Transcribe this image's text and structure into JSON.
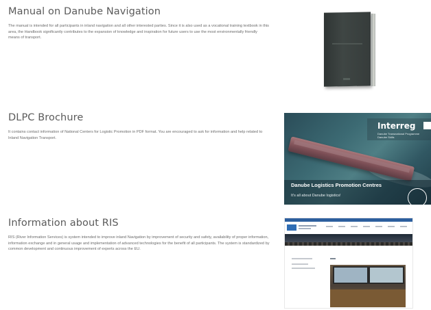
{
  "sections": [
    {
      "title": "Manual on Danube Navigation",
      "body": "The manual is intended for all participants in inland navigation and all other interested parties. Since it is also used as a vocational training textbook in this area, the Handbook significantly contributes to the expansion of knowledge and inspiration for future users to use the most environmentally friendly means of transport."
    },
    {
      "title": "DLPC Brochure",
      "body": "It contains contact information of National Centers for Logistic Promotion in PDF format. You are encouraged to ask for information and help related to Inland Navigation Transport."
    },
    {
      "title": "Information about RIS",
      "body": "RIS (River Information Services) is system intended to improve inland Navigation by improvement of security and safety, availability of proper information, information exchange and in general usage and implementation of advanced technologies for the benefit of all participants. The system is standardized by common development and continuous improvement of experts across the EU."
    }
  ],
  "brochure_image": {
    "logo": "Interreg",
    "subtitle": "Danube Transnational Programme Danube Skills",
    "title": "Danube Logistics Promotion Centres",
    "tagline": "It's all about Danube logistics!"
  }
}
